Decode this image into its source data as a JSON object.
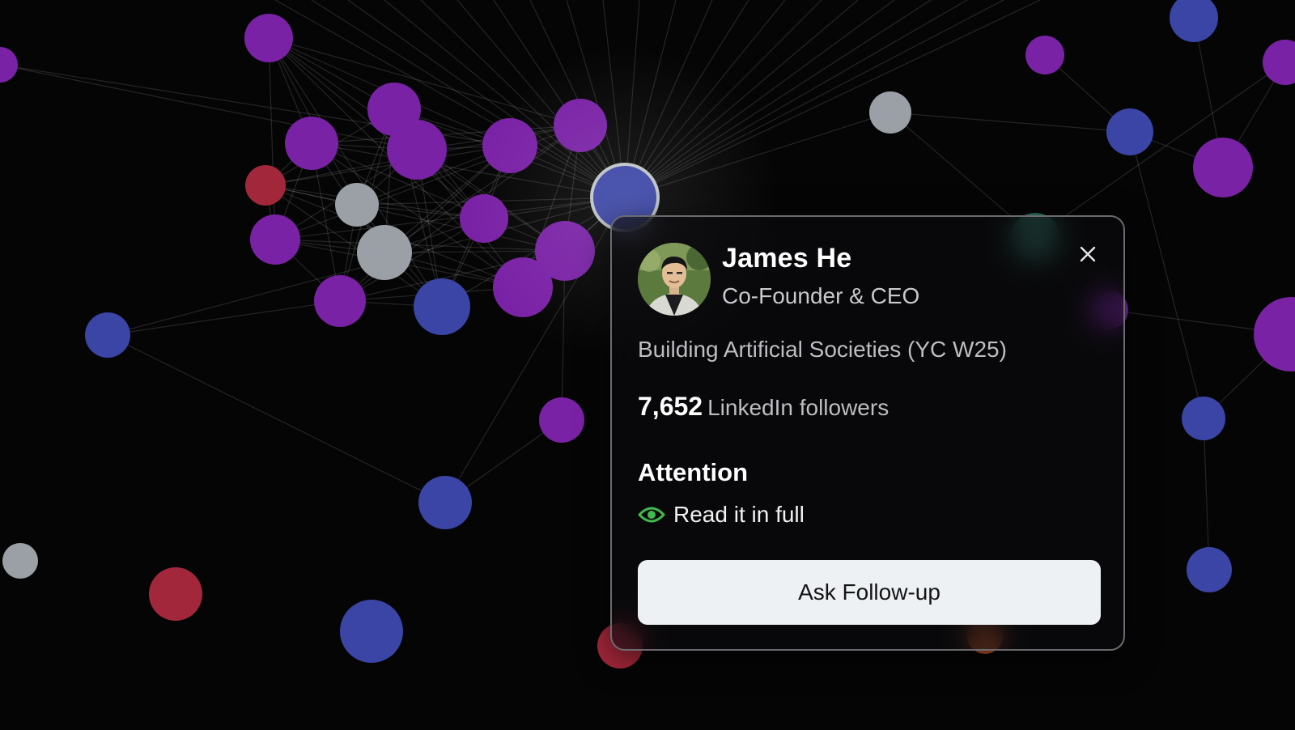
{
  "profile": {
    "name": "James He",
    "role": "Co-Founder & CEO",
    "tagline": "Building Artificial Societies (YC W25)",
    "followers_count": "7,652",
    "followers_label": "LinkedIn followers"
  },
  "attention": {
    "title": "Attention",
    "status": "Read it in full",
    "status_icon": "eye-icon",
    "status_color": "#43b84c"
  },
  "actions": {
    "ask_followup_label": "Ask Follow-up",
    "close_icon": "close-icon"
  },
  "graph": {
    "node_colors": {
      "purple": "#7a22a6",
      "blue": "#3a45a6",
      "gray": "#9aa0a6",
      "red": "#a3273a",
      "teal": "#2d6b5c",
      "orange": "#b2502a"
    },
    "selected_node_ring": "#bfc2c6"
  }
}
